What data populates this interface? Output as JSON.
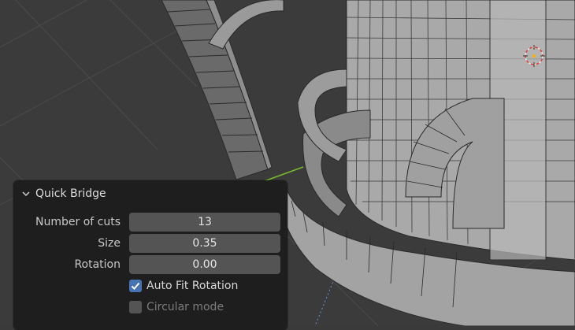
{
  "panel": {
    "title": "Quick Bridge",
    "fields": {
      "number_of_cuts": {
        "label": "Number of cuts",
        "value": "13"
      },
      "size": {
        "label": "Size",
        "value": "0.35"
      },
      "rotation": {
        "label": "Rotation",
        "value": "0.00"
      }
    },
    "checkboxes": {
      "auto_fit_rotation": {
        "label": "Auto Fit Rotation",
        "checked": true
      },
      "circular_mode": {
        "label": "Circular mode",
        "checked": false
      }
    }
  },
  "colors": {
    "background": "#3a3a3a",
    "panel": "#1e1e1e",
    "field": "#545454",
    "accent": "#4772b3",
    "mesh": "#9a9a9a",
    "selected_edge": "#ff8a00",
    "y_axis": "#7dbb2a"
  },
  "icons": {
    "collapse": "chevron-down-icon",
    "checkmark": "check-icon",
    "cursor": "3d-cursor-icon"
  }
}
